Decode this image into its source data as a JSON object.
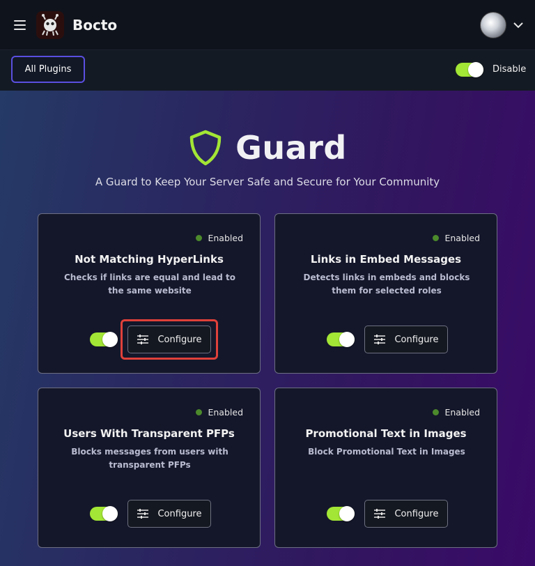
{
  "app": {
    "name": "Bocto"
  },
  "toolbar": {
    "all_plugins_label": "All Plugins",
    "disable_label": "Disable",
    "toggle_on": true
  },
  "hero": {
    "title": "Guard",
    "subtitle": "A Guard to Keep Your Server Safe and Secure for Your Community"
  },
  "cards": [
    {
      "status": "Enabled",
      "title": "Not Matching HyperLinks",
      "description": "Checks if links are equal and lead to the same website",
      "configure_label": "Configure",
      "enabled": true,
      "highlighted": true
    },
    {
      "status": "Enabled",
      "title": "Links in Embed Messages",
      "description": "Detects links in embeds and blocks them for selected roles",
      "configure_label": "Configure",
      "enabled": true
    },
    {
      "status": "Enabled",
      "title": "Users With Transparent PFPs",
      "description": "Blocks messages from users with transparent PFPs",
      "configure_label": "Configure",
      "enabled": true
    },
    {
      "status": "Enabled",
      "title": "Promotional Text in Images",
      "description": "Block Promotional Text in Images",
      "configure_label": "Configure",
      "enabled": true
    }
  ],
  "colors": {
    "accent": "#a3e635",
    "status_dot": "#4c8a2c",
    "highlight": "#e0413a",
    "button_border": "#5a4fe0"
  },
  "icons": {
    "menu": "hamburger-icon",
    "logo": "bocto-logo",
    "avatar": "user-avatar",
    "chevron": "chevron-down-icon",
    "shield": "shield-icon",
    "configure": "sliders-icon"
  }
}
